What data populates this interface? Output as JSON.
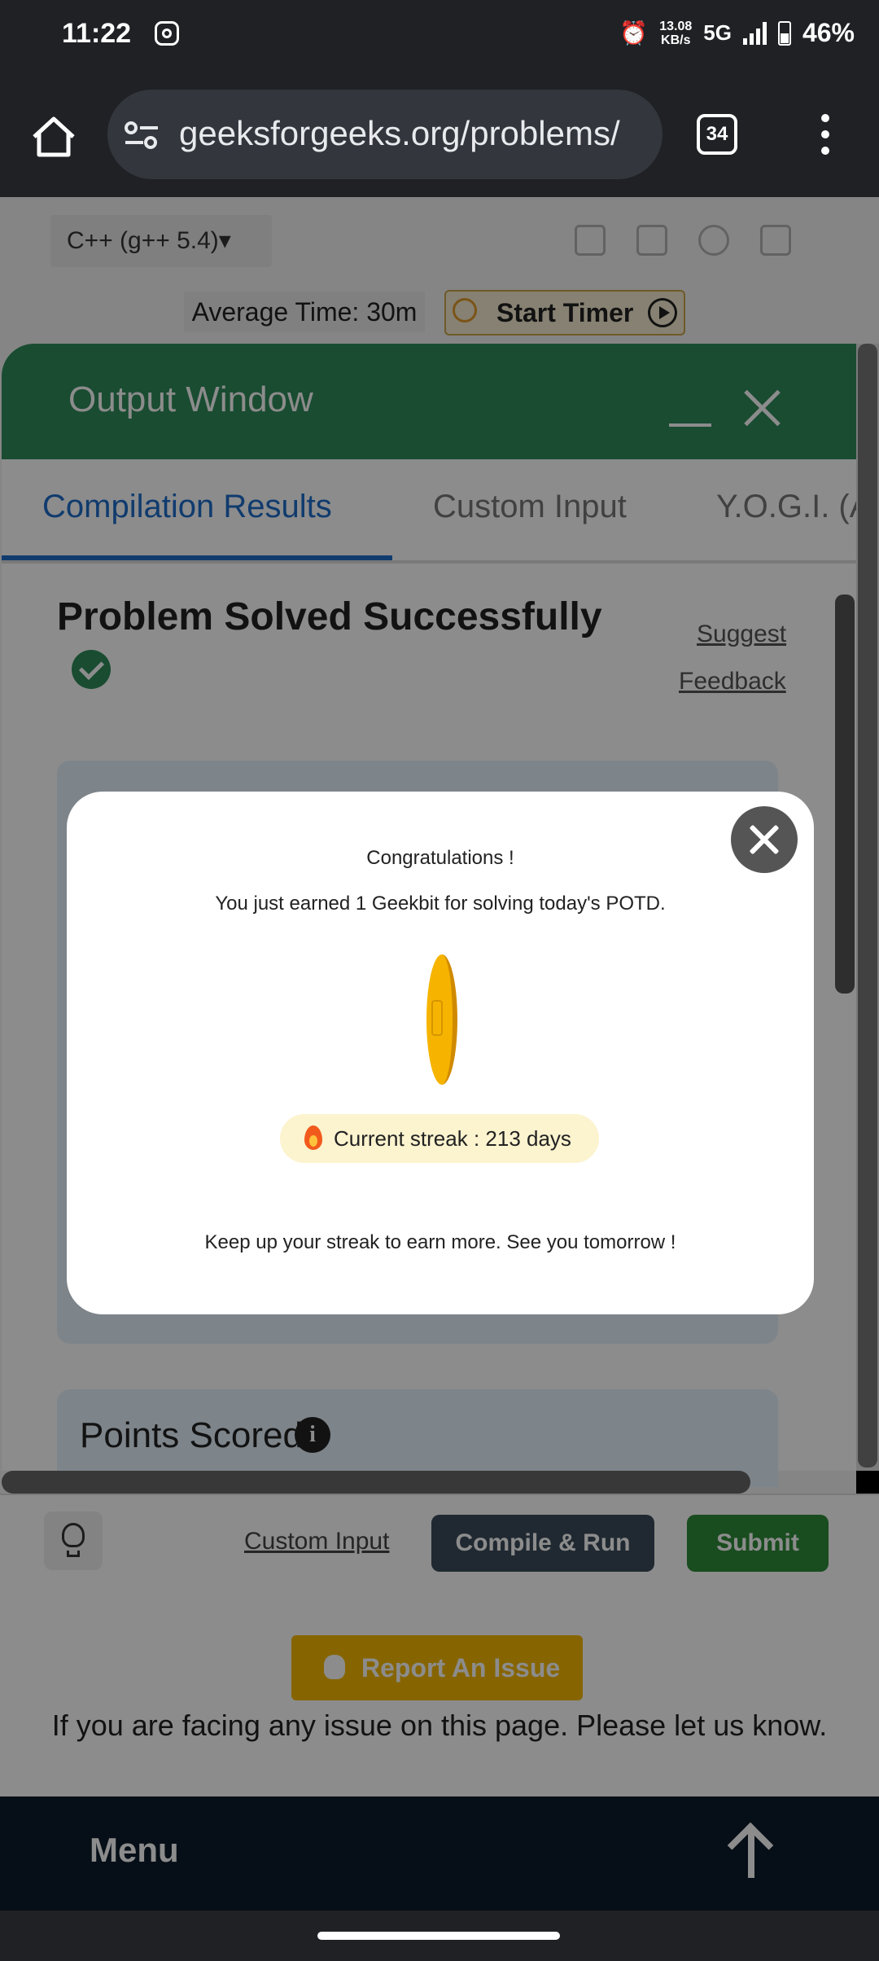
{
  "status_bar": {
    "time": "11:22",
    "speed_value": "13.08",
    "speed_unit": "KB/s",
    "network": "5G",
    "battery": "46%"
  },
  "browser": {
    "url": "geeksforgeeks.org/problems/",
    "tab_count": "34"
  },
  "editor": {
    "language": "C++ (g++ 5.4)▾",
    "average_time": "Average Time: 30m",
    "start_timer": "Start Timer"
  },
  "output_window": {
    "title": "Output Window",
    "tabs": [
      "Compilation Results",
      "Custom Input",
      "Y.O.G.I. (A"
    ],
    "status_title": "Problem Solved Successfully",
    "suggest": "Suggest",
    "feedback": "Feedback",
    "points_scored": "Points Scored",
    "info_glyph": "i"
  },
  "actions": {
    "custom_input": "Custom Input",
    "compile_run": "Compile & Run",
    "submit": "Submit"
  },
  "report": {
    "button": "Report An Issue",
    "note": "If you are facing any issue on this page. Please let us know."
  },
  "footer": {
    "menu": "Menu"
  },
  "modal": {
    "congrats": "Congratulations !",
    "earned": "You just earned 1 Geekbit for solving today's POTD.",
    "streak": "Current streak : 213 days",
    "keep_up": "Keep up your streak to earn more. See you tomorrow !"
  },
  "colors": {
    "output_header": "#2f8a5a",
    "active_tab": "#1e6cc8",
    "submit": "#2f8a3a",
    "report": "#f5b800",
    "coin": "#f6b400"
  },
  "icons": [
    "home-icon",
    "tune-icon",
    "tabs-icon",
    "more-vert-icon",
    "alarm-icon",
    "play-icon",
    "close-icon",
    "check-circle-icon",
    "info-icon",
    "bulb-icon",
    "bug-icon",
    "arrow-up-icon",
    "coin-icon",
    "fire-icon"
  ]
}
